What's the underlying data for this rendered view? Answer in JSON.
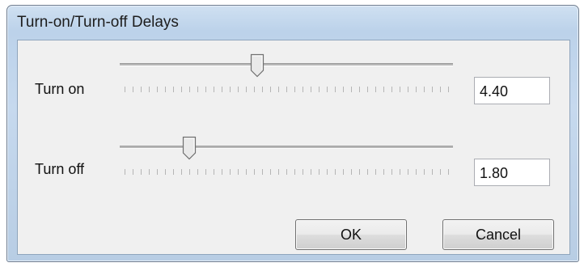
{
  "window": {
    "title": "Turn-on/Turn-off Delays"
  },
  "turn_on": {
    "label": "Turn on",
    "value": "4.40",
    "slider_fraction": 0.41
  },
  "turn_off": {
    "label": "Turn off",
    "value": "1.80",
    "slider_fraction": 0.2
  },
  "buttons": {
    "ok": "OK",
    "cancel": "Cancel"
  }
}
